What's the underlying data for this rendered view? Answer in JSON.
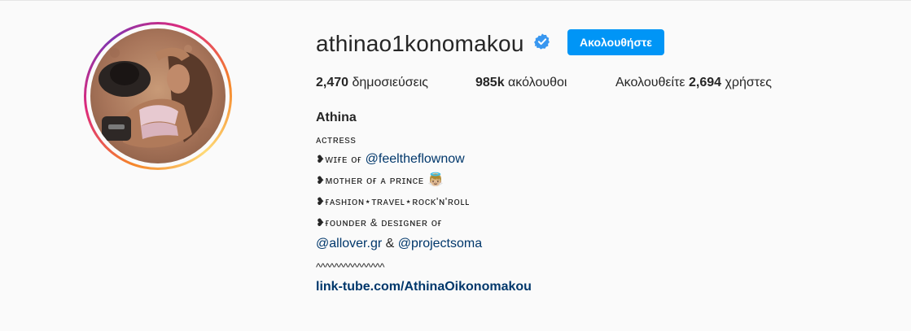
{
  "profile": {
    "username": "athinao1konomakou",
    "follow_label": "Ακολουθήστε",
    "stats": {
      "posts_count": "2,470",
      "posts_label": "δημοσιεύσεις",
      "followers_count": "985k",
      "followers_label": "ακόλουθοι",
      "following_prefix": "Ακολουθείτε",
      "following_count": "2,694",
      "following_suffix": "χρήστες"
    },
    "full_name": "Athina",
    "bio": {
      "line1": "ᴀᴄᴛʀᴇss",
      "line2_text": "❥ᴡɪғᴇ ᴏғ ",
      "line2_mention": "@feeltheflownow",
      "line3_text": "❥ᴍᴏᴛʜᴇʀ ᴏғ ᴀ ᴘʀɪɴᴄᴇ ",
      "line3_emoji": "👼🏼",
      "line4": "❥ғᴀsʜɪᴏɴ⋆ᴛʀᴀᴠᴇʟ⋆ʀᴏᴄᴋ'ɴ'ʀᴏʟʟ",
      "line5": "❥ғᴏᴜɴᴅᴇʀ & ᴅᴇsɪɢɴᴇʀ ᴏғ",
      "line6_mention1": "@allover.gr",
      "line6_sep": " & ",
      "line6_mention2": "@projectsoma",
      "line7": "^^^^^^^^^^^^^^^",
      "website": "link-tube.com/AthinaOikonomakou"
    }
  },
  "colors": {
    "accent": "#0095f6",
    "link": "#00376b",
    "text": "#262626",
    "background": "#fafafa"
  }
}
